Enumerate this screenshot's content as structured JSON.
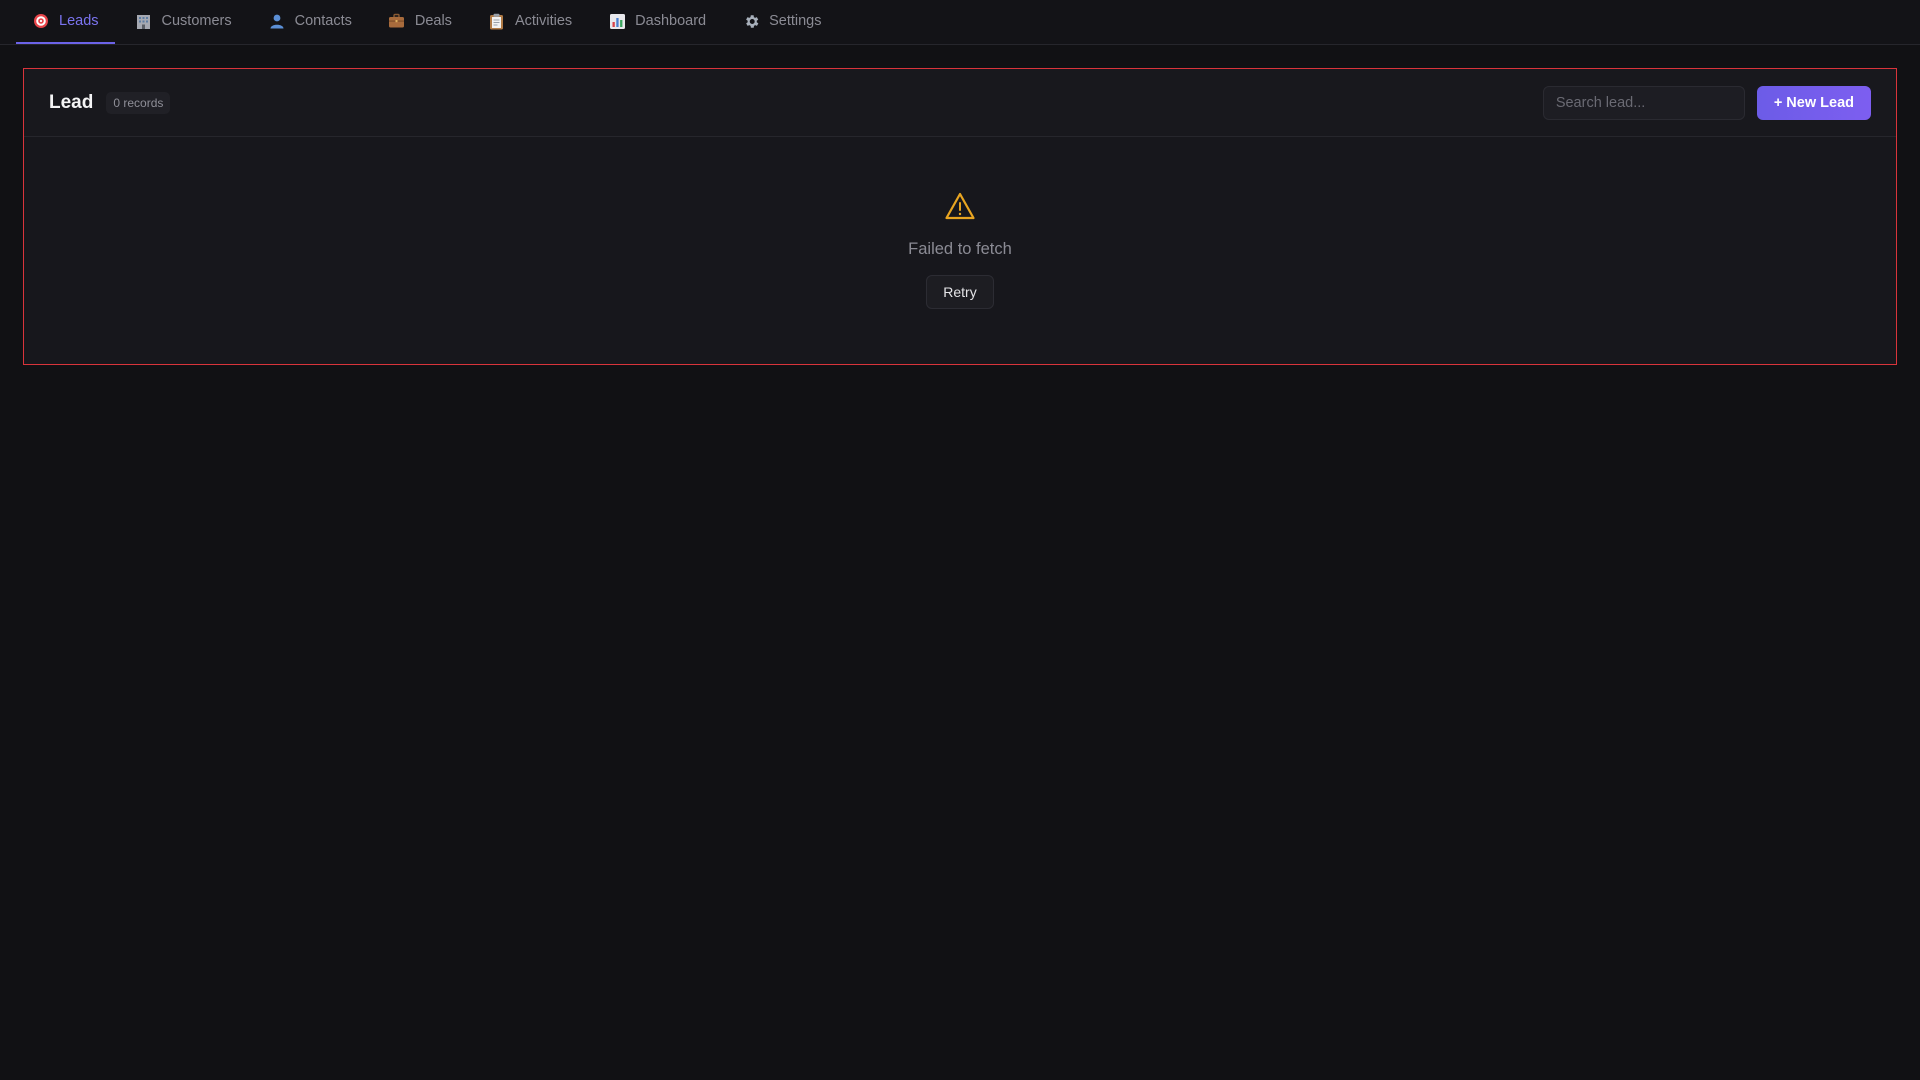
{
  "nav": {
    "tabs": [
      {
        "label": "Leads",
        "icon": "target-icon",
        "active": true
      },
      {
        "label": "Customers",
        "icon": "building-icon",
        "active": false
      },
      {
        "label": "Contacts",
        "icon": "person-icon",
        "active": false
      },
      {
        "label": "Deals",
        "icon": "briefcase-icon",
        "active": false
      },
      {
        "label": "Activities",
        "icon": "clipboard-icon",
        "active": false
      },
      {
        "label": "Dashboard",
        "icon": "bar-chart-icon",
        "active": false
      },
      {
        "label": "Settings",
        "icon": "gear-icon",
        "active": false
      }
    ]
  },
  "panel": {
    "title": "Lead",
    "records_badge": "0 records",
    "search_placeholder": "Search lead...",
    "new_button_label": "+ New Lead",
    "error_icon": "warning-icon",
    "error_message": "Failed to fetch",
    "retry_label": "Retry"
  },
  "colors": {
    "accent": "#6c63e8",
    "error_border": "#d9343b",
    "warning": "#e8a521",
    "background": "#111114"
  }
}
